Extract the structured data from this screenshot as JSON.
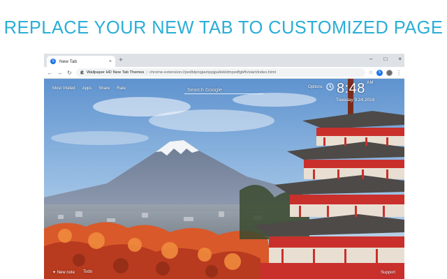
{
  "headline": "REPLACE YOUR NEW TAB TO CUSTOMIZED PAGE",
  "browser": {
    "tab": {
      "favicon": "S",
      "title": "New Tab",
      "close": "×"
    },
    "new_tab": "+",
    "window_controls": {
      "minimize": "–",
      "maximize": "□",
      "close": "×"
    },
    "toolbar": {
      "back": "←",
      "forward": "→",
      "reload": "↻",
      "extension_name": "Wallpaper HD New Tab Themes",
      "separator": "|",
      "url": "chrome-extension://pedblpnigiamppjpallokldmpedfgbfh/start/index.html",
      "star": "☆",
      "ext_badge": "S",
      "menu": "⋮"
    }
  },
  "newtab": {
    "nav": [
      "Most Visited",
      "Apps",
      "Share",
      "Rate"
    ],
    "search_placeholder": "Search Google",
    "options": "Options",
    "time": "8:48",
    "ampm": "AM",
    "date": "Tuesday  9.24.2019",
    "bottom_left": [
      "✦ New note",
      "Todo"
    ],
    "bottom_right": "Support"
  },
  "colors": {
    "headline": "#2aaed6",
    "sky_top": "#6fa2d8",
    "pagoda_red": "#c9302c",
    "foliage": "#e2672a"
  }
}
